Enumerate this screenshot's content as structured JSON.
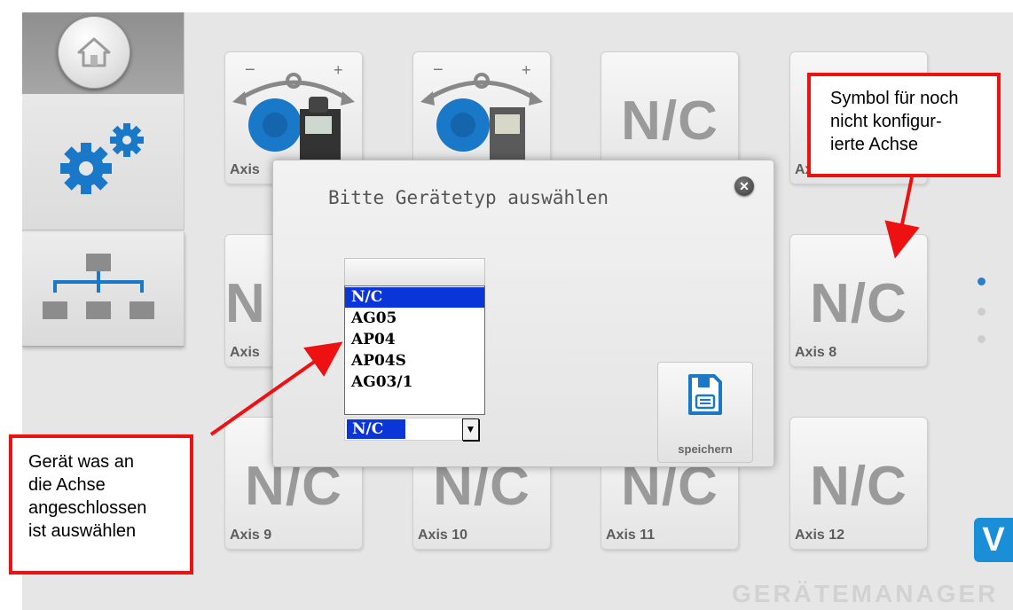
{
  "sidebar": {
    "home_icon": "home-icon",
    "settings_icon": "gears-icon",
    "network_icon": "network-hierarchy-icon"
  },
  "tiles": [
    {
      "label": "Axis",
      "content": "device-ag05-icon"
    },
    {
      "label": "",
      "content": "device-ap04-icon"
    },
    {
      "label": "",
      "nc": "N/C"
    },
    {
      "label": "Axis 4",
      "nc": ""
    },
    {
      "label": "Axis",
      "nc": "N"
    },
    {
      "label": "Axis 8",
      "nc": "N/C"
    },
    {
      "label": "Axis 9",
      "nc": "N/C"
    },
    {
      "label": "Axis 10",
      "nc": "N/C"
    },
    {
      "label": "Axis 11",
      "nc": "N/C"
    },
    {
      "label": "Axis 12",
      "nc": "N/C"
    }
  ],
  "pager": {
    "pages": 3,
    "current": 1
  },
  "logo": {
    "letter": "V"
  },
  "brand": "GERÄTEMANAGER",
  "dialog": {
    "title": "Bitte Gerätetyp auswählen",
    "close_icon": "close-icon",
    "options": [
      "N/C",
      "AG05",
      "AP04",
      "AP04S",
      "AG03/1"
    ],
    "selected": "N/C",
    "save_label": "speichern",
    "save_icon": "floppy-disk-icon"
  },
  "annotations": {
    "left": [
      "Gerät was an",
      "die Achse",
      "angeschlossen",
      "ist auswählen"
    ],
    "right": [
      "Symbol für noch",
      "nicht konfigur-",
      "ierte Achse"
    ]
  },
  "colors": {
    "accent": "#2b7fc7",
    "selection": "#0a35d8",
    "annotation": "#ee1111",
    "logo": "#1a8fd8"
  }
}
